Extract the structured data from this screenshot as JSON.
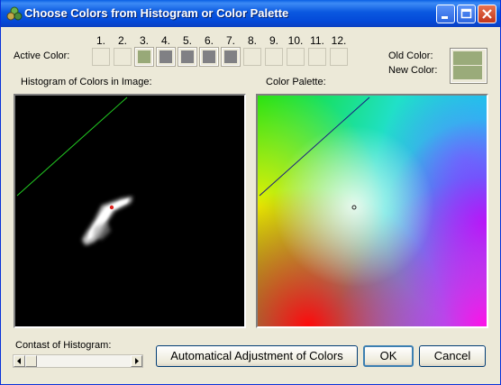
{
  "window": {
    "title": "Choose Colors from Histogram or Color Palette"
  },
  "active_color": {
    "label": "Active Color:",
    "slots": [
      {
        "number": "1.",
        "color": null
      },
      {
        "number": "2.",
        "color": null
      },
      {
        "number": "3.",
        "color": "#98a978"
      },
      {
        "number": "4.",
        "color": "#808084"
      },
      {
        "number": "5.",
        "color": "#808084"
      },
      {
        "number": "6.",
        "color": "#808084"
      },
      {
        "number": "7.",
        "color": "#808084"
      },
      {
        "number": "8.",
        "color": null
      },
      {
        "number": "9.",
        "color": null
      },
      {
        "number": "10.",
        "color": null
      },
      {
        "number": "11.",
        "color": null
      },
      {
        "number": "12.",
        "color": null
      }
    ]
  },
  "old_color": {
    "label": "Old Color:",
    "color": "#9aab7a"
  },
  "new_color": {
    "label": "New Color:",
    "color": "#9aab7a"
  },
  "histogram": {
    "label": "Histogram of Colors in Image:"
  },
  "palette": {
    "label": "Color Palette:"
  },
  "contrast": {
    "label": "Contast of Histogram:",
    "value": 0.0
  },
  "buttons": {
    "auto_adjust": "Automatical Adjustment of Colors",
    "ok": "OK",
    "cancel": "Cancel"
  },
  "colors": {
    "titlebar": "#0a58e0",
    "window_bg": "#ece9d8",
    "histogram_line": "#22cc22",
    "palette_line": "#1a1a80",
    "marker": "#e0201c"
  }
}
